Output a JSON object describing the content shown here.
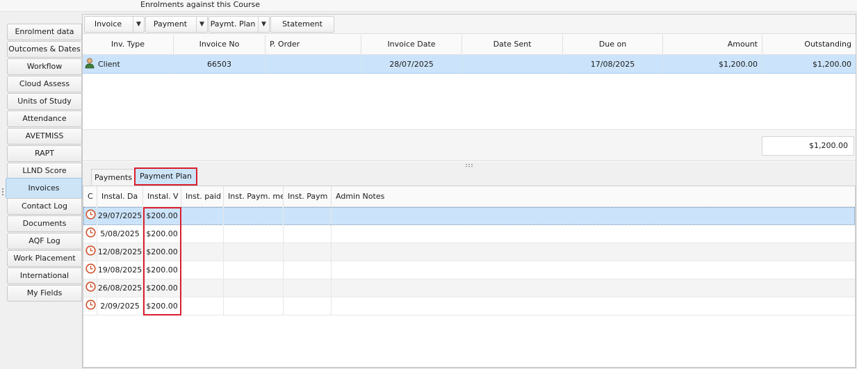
{
  "header": {
    "title": "Enrolments against this Course"
  },
  "nav": {
    "items": [
      {
        "label": "Enrolment data"
      },
      {
        "label": "Outcomes & Dates"
      },
      {
        "label": "Workflow"
      },
      {
        "label": "Cloud Assess"
      },
      {
        "label": "Units of Study"
      },
      {
        "label": "Attendance"
      },
      {
        "label": "AVETMISS"
      },
      {
        "label": "RAPT"
      },
      {
        "label": "LLND Score"
      },
      {
        "label": "Invoices"
      },
      {
        "label": "Contact Log"
      },
      {
        "label": "Documents"
      },
      {
        "label": "AQF Log"
      },
      {
        "label": "Work Placement"
      },
      {
        "label": "International"
      },
      {
        "label": "My Fields"
      }
    ],
    "active": "Invoices"
  },
  "toolbar": {
    "invoice_label": "Invoice",
    "payment_label": "Payment",
    "paymt_plan_label": "Paymt. Plan",
    "statement_label": "Statement",
    "arrow": "▼"
  },
  "invoices": {
    "columns": [
      "Inv. Type",
      "Invoice No",
      "P. Order",
      "Invoice Date",
      "Date Sent",
      "Due on",
      "Amount",
      "Outstanding"
    ],
    "rows": [
      {
        "inv_type": "Client",
        "invoice_no": "66503",
        "p_order": "",
        "invoice_date": "28/07/2025",
        "date_sent": "",
        "due_on": "17/08/2025",
        "amount": "$1,200.00",
        "outstanding": "$1,200.00"
      }
    ],
    "total": "$1,200.00"
  },
  "lower_tabs": {
    "payments": "Payments",
    "payment_plan": "Payment Plan",
    "active": "Payment Plan"
  },
  "payment_plan": {
    "columns": [
      "C",
      "Instal. Da",
      "Instal. V",
      "Inst. paid",
      "Inst. Paym. me",
      "Inst. Paym",
      "Admin Notes"
    ],
    "rows": [
      {
        "date": "29/07/2025",
        "value": "$200.00"
      },
      {
        "date": "5/08/2025",
        "value": "$200.00"
      },
      {
        "date": "12/08/2025",
        "value": "$200.00"
      },
      {
        "date": "19/08/2025",
        "value": "$200.00"
      },
      {
        "date": "26/08/2025",
        "value": "$200.00"
      },
      {
        "date": "2/09/2025",
        "value": "$200.00"
      }
    ]
  },
  "colors": {
    "selection": "#cce4fb",
    "highlight": "#d81e2c",
    "clock": "#d0502a"
  },
  "icons": {
    "row_type_icon": "user-icon",
    "instalment_icon": "clock-icon",
    "dropdown": "chevron-down-icon"
  }
}
